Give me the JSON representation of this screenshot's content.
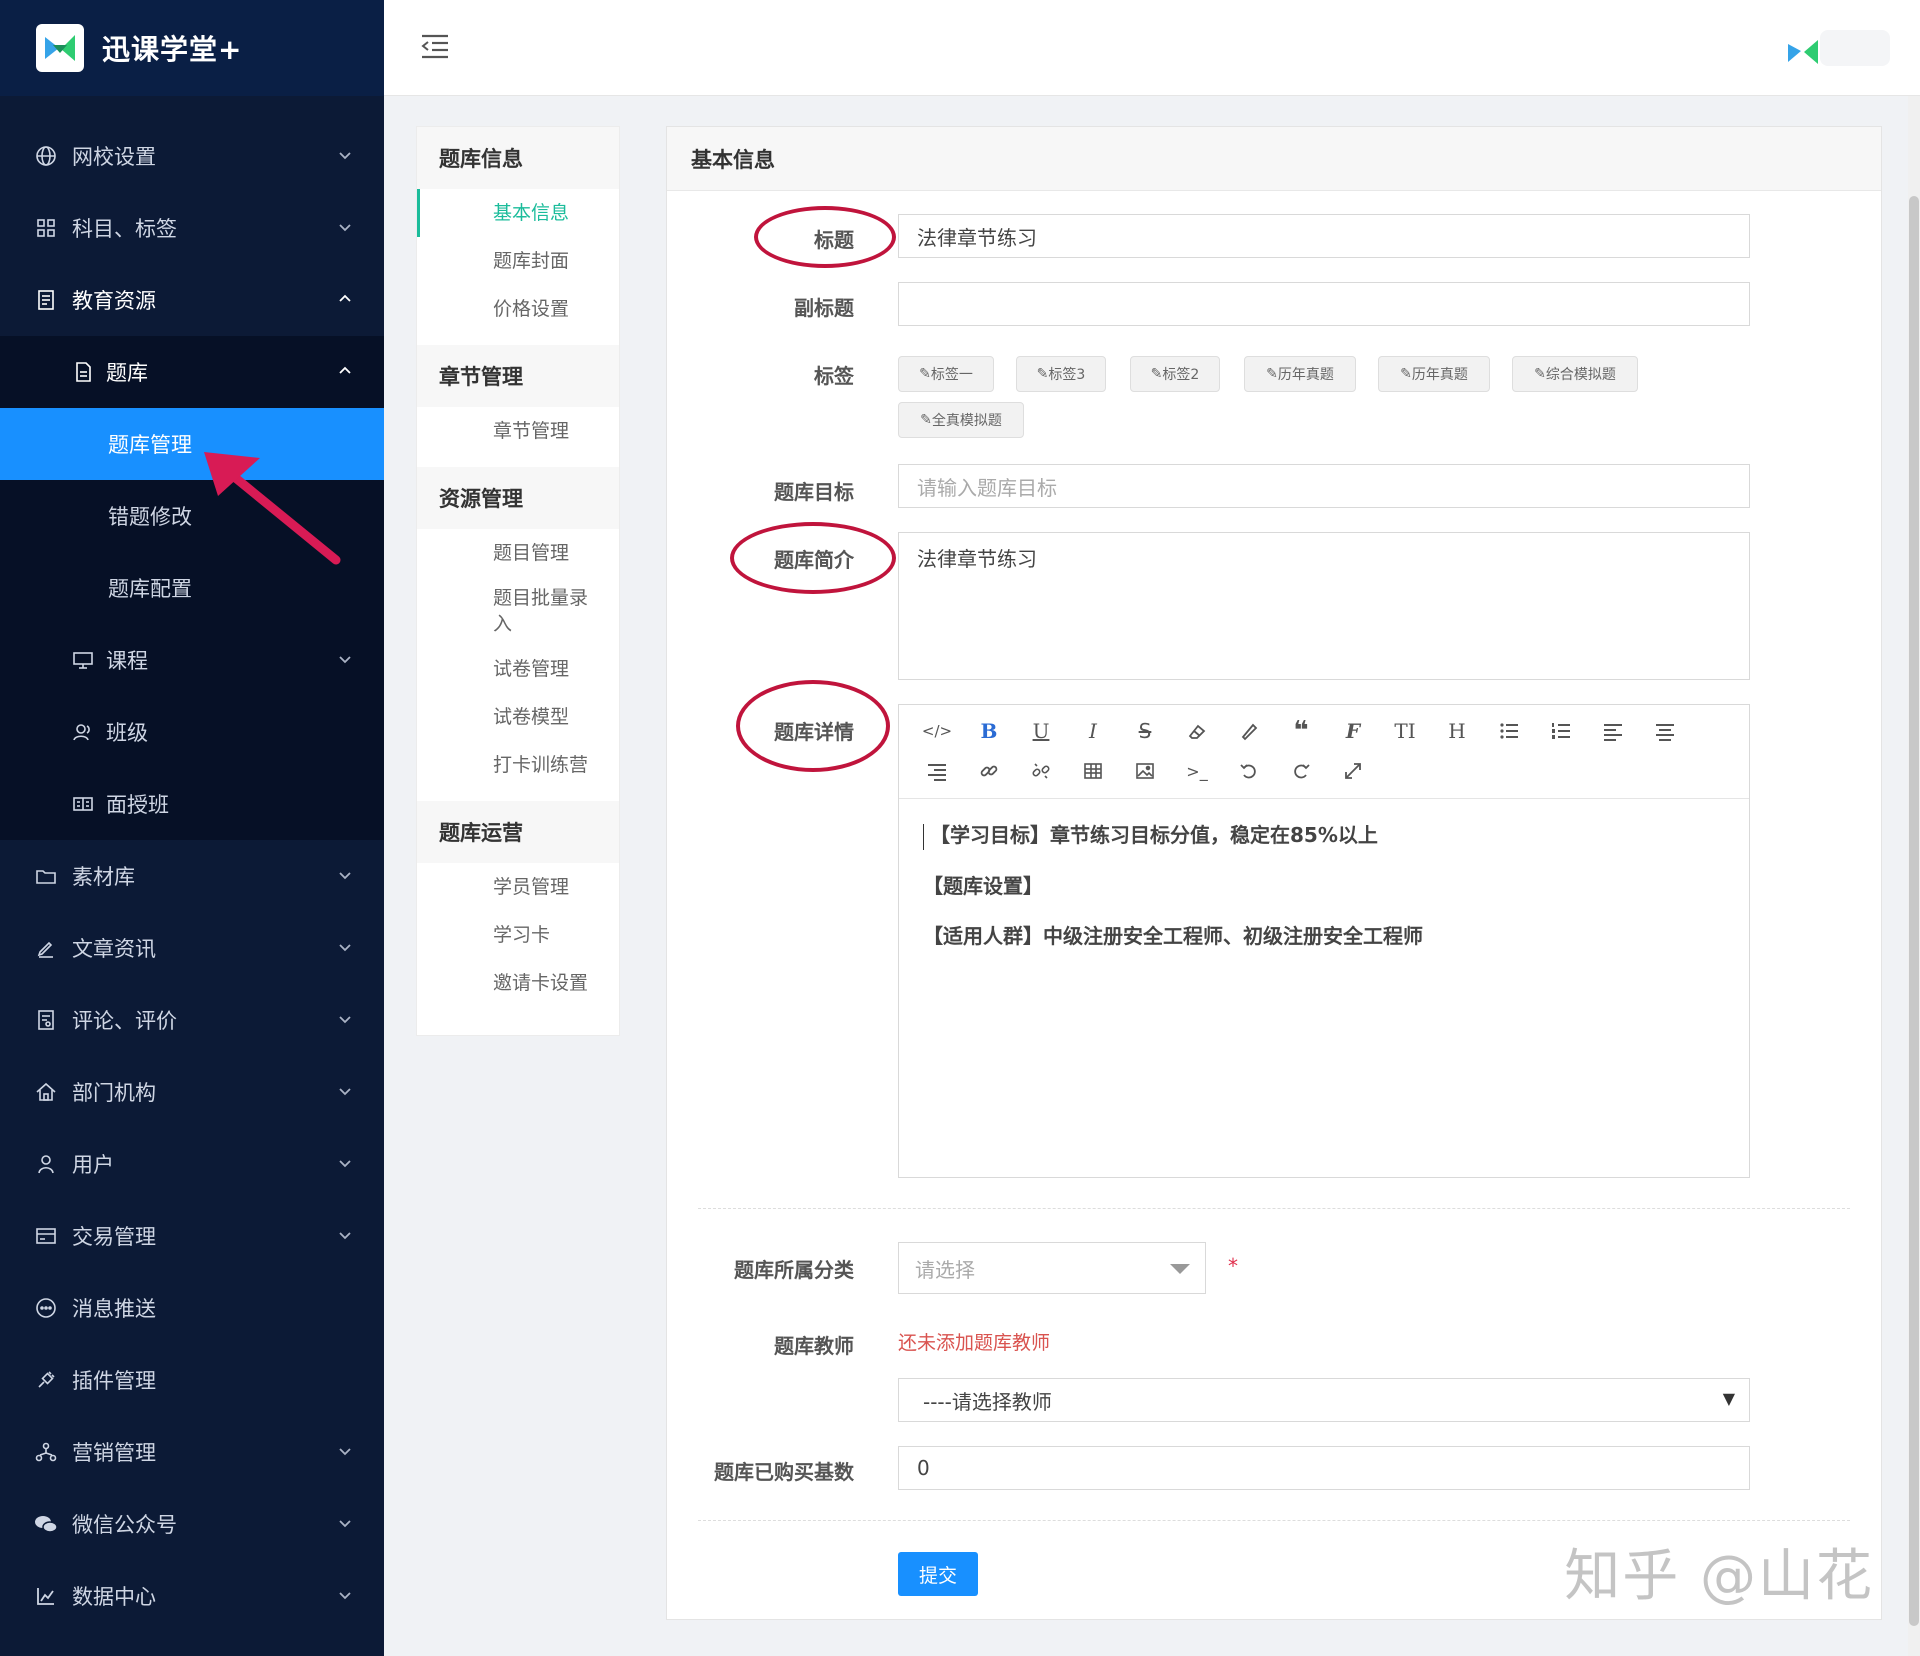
{
  "brand": {
    "name": "迅课学堂+"
  },
  "sidebar": {
    "items_top": [
      {
        "label": "网校设置",
        "icon": "globe-icon"
      },
      {
        "label": "科目、标签",
        "icon": "grid-icon"
      }
    ],
    "edu": {
      "label": "教育资源",
      "icon": "book-icon"
    },
    "tiku": {
      "label": "题库",
      "icon": "file-icon"
    },
    "tiku_children": [
      "题库管理",
      "错题修改",
      "题库配置"
    ],
    "edu_children": [
      {
        "label": "课程",
        "icon": "monitor-icon"
      },
      {
        "label": "班级",
        "icon": "users-icon"
      },
      {
        "label": "面授班",
        "icon": "reader-icon"
      }
    ],
    "items_bottom": [
      {
        "label": "素材库",
        "icon": "folder-icon"
      },
      {
        "label": "文章资讯",
        "icon": "pen-icon"
      },
      {
        "label": "评论、评价",
        "icon": "comment-icon"
      },
      {
        "label": "部门机构",
        "icon": "home-icon"
      },
      {
        "label": "用户",
        "icon": "user-icon"
      },
      {
        "label": "交易管理",
        "icon": "wallet-icon"
      },
      {
        "label": "消息推送",
        "icon": "message-icon"
      },
      {
        "label": "插件管理",
        "icon": "plugin-icon"
      },
      {
        "label": "营销管理",
        "icon": "network-icon"
      },
      {
        "label": "微信公众号",
        "icon": "wechat-icon"
      },
      {
        "label": "数据中心",
        "icon": "chart-icon"
      }
    ]
  },
  "subnav": {
    "groups": [
      {
        "title": "题库信息",
        "links": [
          "基本信息",
          "题库封面",
          "价格设置"
        ]
      },
      {
        "title": "章节管理",
        "links": [
          "章节管理"
        ]
      },
      {
        "title": "资源管理",
        "links": [
          "题目管理",
          "题目批量录入",
          "试卷管理",
          "试卷模型",
          "打卡训练营"
        ]
      },
      {
        "title": "题库运营",
        "links": [
          "学员管理",
          "学习卡",
          "邀请卡设置"
        ]
      }
    ]
  },
  "form": {
    "panel_title": "基本信息",
    "title_label": "标题",
    "title_value": "法律章节练习",
    "subtitle_label": "副标题",
    "subtitle_value": "",
    "tags_label": "标签",
    "tags": [
      "标签一",
      "标签3",
      "标签2",
      "历年真题",
      "历年真题",
      "综合模拟题",
      "全真模拟题"
    ],
    "goal_label": "题库目标",
    "goal_placeholder": "请输入题库目标",
    "intro_label": "题库简介",
    "intro_value": "法律章节练习",
    "detail_label": "题库详情",
    "detail_lines": [
      "【学习目标】章节练习目标分值，稳定在85%以上",
      "【题库设置】",
      "【适用人群】中级注册安全工程师、初级注册安全工程师"
    ],
    "category_label": "题库所属分类",
    "category_placeholder": "请选择",
    "required_mark": "*",
    "teacher_label": "题库教师",
    "teacher_warning": "还未添加题库教师",
    "teacher_select": "----请选择教师",
    "purchase_label": "题库已购买基数",
    "purchase_value": "0",
    "submit_label": "提交"
  },
  "toolbar_row1": [
    "code-icon",
    "bold-icon",
    "underline-icon",
    "italic-icon",
    "strikethrough-icon",
    "eraser-icon",
    "brush-icon",
    "quote-icon",
    "font-icon",
    "text-size-icon",
    "heading-icon",
    "bullet-list-icon",
    "ordered-list-icon",
    "align-left-icon",
    "align-center-icon"
  ],
  "toolbar_row2": [
    "align-right-icon",
    "link-icon",
    "unlink-icon",
    "table-icon",
    "image-icon",
    "terminal-icon",
    "undo-icon",
    "redo-icon",
    "fullscreen-icon"
  ],
  "watermark": "知乎 @山花",
  "colors": {
    "sidebar_bg": "#0c1a36",
    "active_menu": "#1890ff",
    "accent_green": "#1bbc9b",
    "annotation_red": "#c0143c"
  }
}
